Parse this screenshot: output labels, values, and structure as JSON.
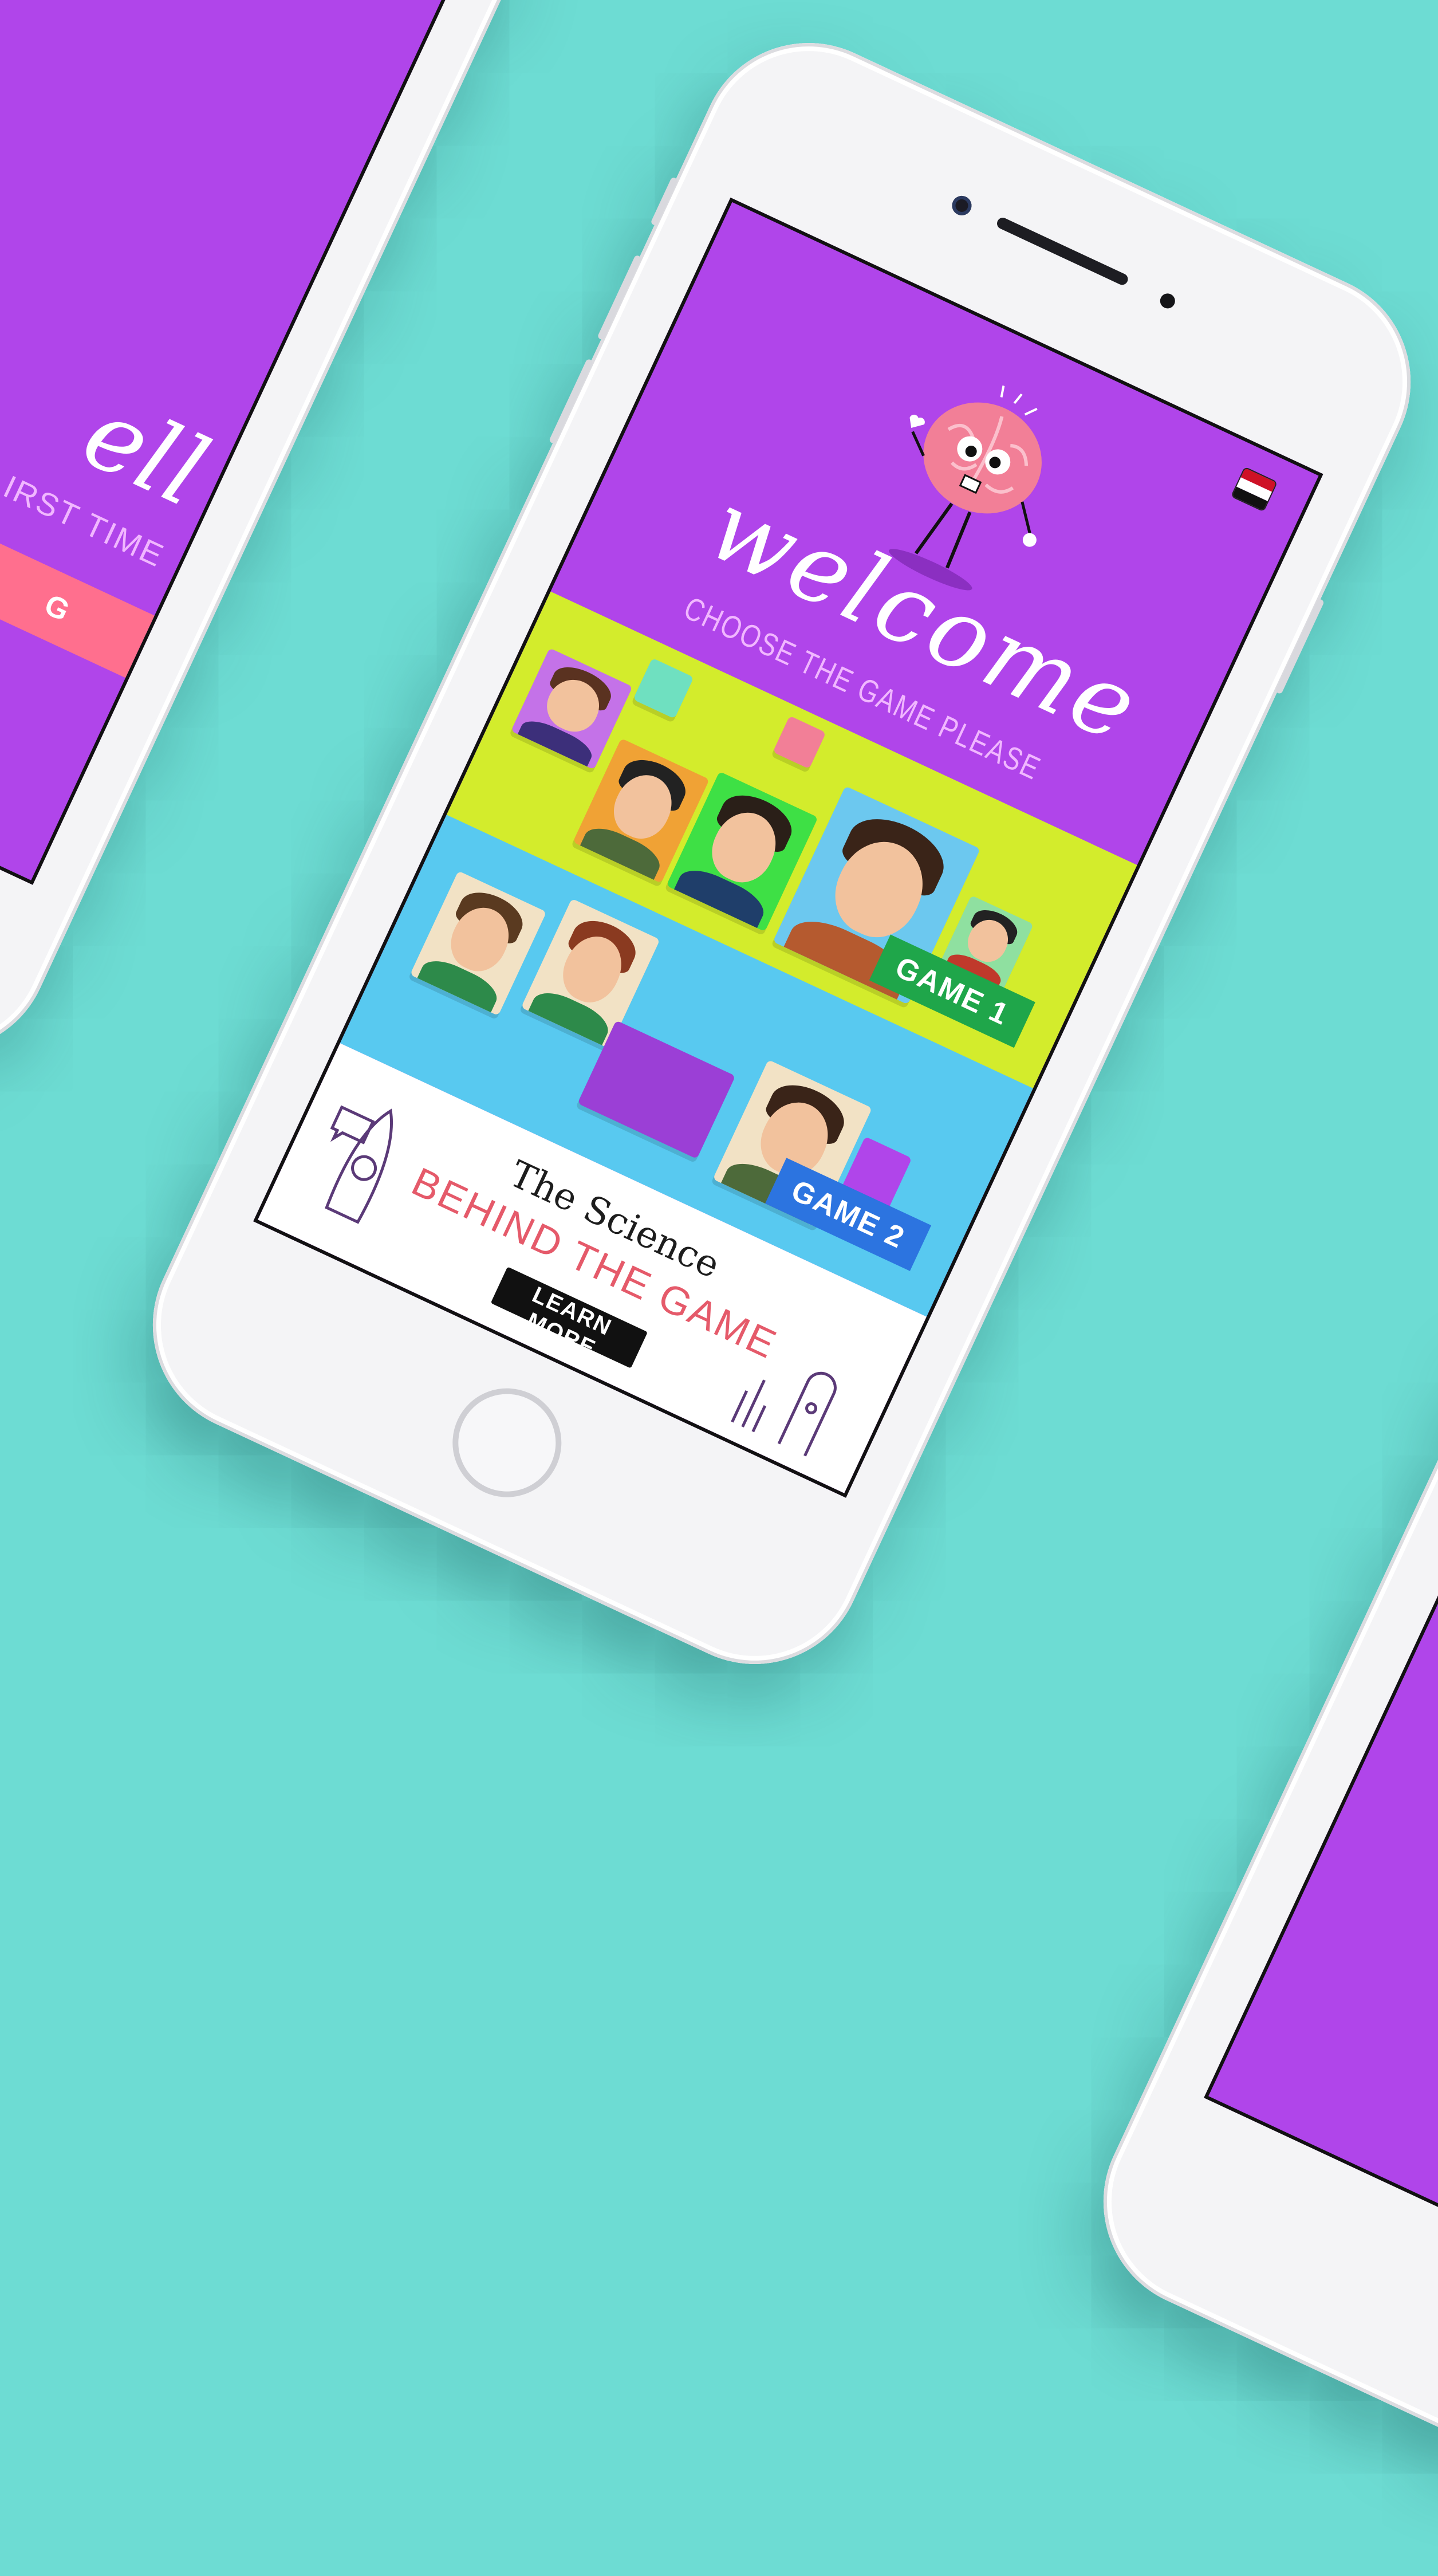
{
  "main_screen": {
    "welcome_title": "welcome",
    "subtitle": "CHOOSE THE GAME PLEASE",
    "game1_label": "GAME 1",
    "game2_label": "GAME 2",
    "science_line1": "The Science",
    "science_line2": "BEHIND THE GAME",
    "learn_more_label": "LEARN MORE",
    "language_flag": "egypt-flag-icon"
  },
  "left_screen": {
    "welcome_fragment": "ell",
    "first_time_fragment": "IRST TIME",
    "start_button_fragment": "G"
  },
  "colors": {
    "background": "#6ddcd3",
    "screen_purple": "#b045ea",
    "game1_bg": "#d3ec2c",
    "game2_bg": "#58c9f0",
    "game1_tag": "#1fa64a",
    "game2_tag": "#2c74e0",
    "science_accent": "#e55a6a",
    "start_button": "#ff6f8e"
  }
}
